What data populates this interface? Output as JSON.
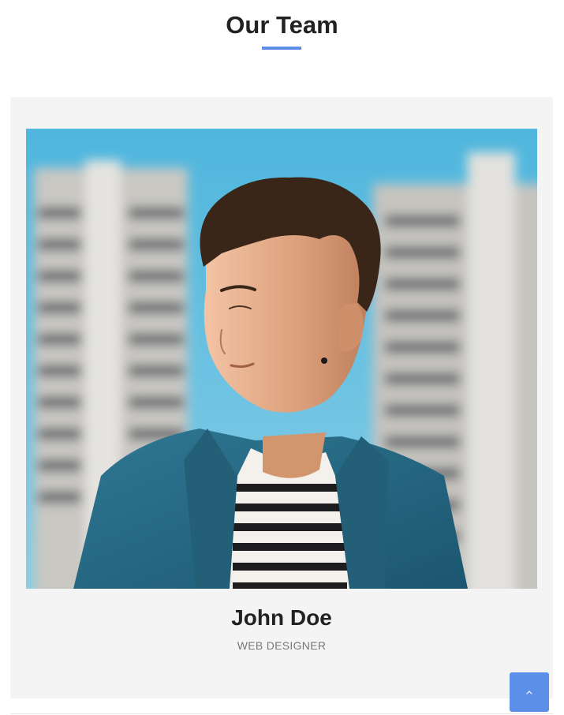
{
  "section": {
    "title": "Our Team"
  },
  "member": {
    "name": "John Doe",
    "role": "WEB DESIGNER",
    "photo_alt": "Portrait of John Doe"
  },
  "scroll_top": {
    "label": "Scroll to top",
    "icon": "chevron-up-icon"
  },
  "colors": {
    "accent": "#5b8fe8",
    "card_background": "#f4f4f4",
    "title_text": "#222222",
    "role_text": "#777777"
  }
}
